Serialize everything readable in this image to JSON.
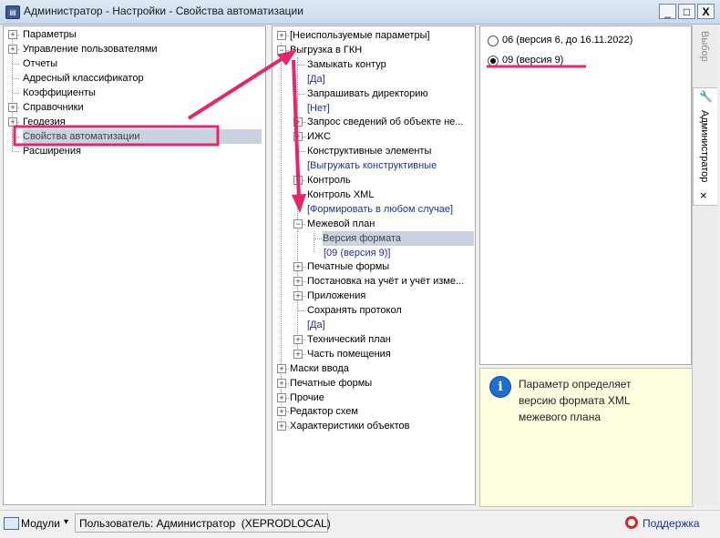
{
  "window": {
    "title": "Администратор - Настройки - Свойства автоматизации",
    "icon_glyph": "▤",
    "minimize": "_",
    "maximize": "□",
    "close": "X"
  },
  "left_tree": [
    {
      "label": "Параметры",
      "expander": "+"
    },
    {
      "label": "Управление пользователями",
      "expander": "+"
    },
    {
      "label": "Отчеты",
      "expander": ""
    },
    {
      "label": "Адресный классификатор",
      "expander": ""
    },
    {
      "label": "Коэффициенты",
      "expander": ""
    },
    {
      "label": "Справочники",
      "expander": "+"
    },
    {
      "label": "Геодезия",
      "expander": "+"
    },
    {
      "label": "Свойства автоматизации",
      "expander": "",
      "selected": true
    },
    {
      "label": "Расширения",
      "expander": ""
    }
  ],
  "mid_tree": [
    {
      "label": "[Неиспользуемые параметры]",
      "level": 0,
      "expander": "+"
    },
    {
      "label": "Выгрузка в ГКН",
      "level": 0,
      "expander": "−"
    },
    {
      "label": "Замыкать контур",
      "level": 1,
      "expander": ""
    },
    {
      "label": "[Да]",
      "level": 1,
      "expander": "",
      "value": true
    },
    {
      "label": "Запрашивать директорию",
      "level": 1,
      "expander": ""
    },
    {
      "label": "[Нет]",
      "level": 1,
      "expander": "",
      "value": true
    },
    {
      "label": "Запрос сведений об объекте не...",
      "level": 1,
      "expander": "+"
    },
    {
      "label": "ИЖС",
      "level": 1,
      "expander": "+"
    },
    {
      "label": "Конструктивные элементы",
      "level": 1,
      "expander": ""
    },
    {
      "label": "[Выгружать конструктивные",
      "level": 1,
      "expander": "",
      "value": true
    },
    {
      "label": "Контроль",
      "level": 1,
      "expander": "+"
    },
    {
      "label": "Контроль XML",
      "level": 1,
      "expander": ""
    },
    {
      "label": "[Формировать в любом случае]",
      "level": 1,
      "expander": "",
      "value": true
    },
    {
      "label": "Межевой план",
      "level": 1,
      "expander": "−"
    },
    {
      "label": "Версия формата",
      "level": 2,
      "expander": "",
      "selected": true
    },
    {
      "label": "[09 (версия 9)]",
      "level": 2,
      "expander": "",
      "value": true
    },
    {
      "label": "Печатные формы",
      "level": 1,
      "expander": "+"
    },
    {
      "label": "Постановка на учёт и учёт изме...",
      "level": 1,
      "expander": "+"
    },
    {
      "label": "Приложения",
      "level": 1,
      "expander": "+"
    },
    {
      "label": "Сохранять протокол",
      "level": 1,
      "expander": ""
    },
    {
      "label": "[Да]",
      "level": 1,
      "expander": "",
      "value": true
    },
    {
      "label": "Технический план",
      "level": 1,
      "expander": "+"
    },
    {
      "label": "Часть помещения",
      "level": 1,
      "expander": "+"
    },
    {
      "label": "Маски ввода",
      "level": 0,
      "expander": "+"
    },
    {
      "label": "Печатные формы",
      "level": 0,
      "expander": "+"
    },
    {
      "label": "Прочие",
      "level": 0,
      "expander": "+"
    },
    {
      "label": "Редактор схем",
      "level": 0,
      "expander": "+"
    },
    {
      "label": "Характеристики объектов",
      "level": 0,
      "expander": "+"
    }
  ],
  "options": [
    {
      "label": "06 (версия 6, до 16.11.2022)",
      "checked": false
    },
    {
      "label": "09 (версия 9)",
      "checked": true
    }
  ],
  "hint": {
    "icon_glyph": "i",
    "line1": "Параметр определяет",
    "line2": "версию формата XML",
    "line3": "межевого плана"
  },
  "side_tabs": {
    "tab1": "Выбор",
    "tab2": "Администратор",
    "close": "×",
    "key_glyph": "🔧"
  },
  "status": {
    "modules_label": "Модули",
    "modules_arrow": "▾",
    "user_text": "Пользователь: Администратор  (XEPRODLOCAL)",
    "support_label": "Поддержка"
  },
  "colors": {
    "highlight_pink": "#e8246b",
    "value_blue": "#1a2fa8",
    "selection": "#c8d2e0",
    "hint_bg": "#fefee0",
    "info_blue": "#1e6fd0"
  }
}
